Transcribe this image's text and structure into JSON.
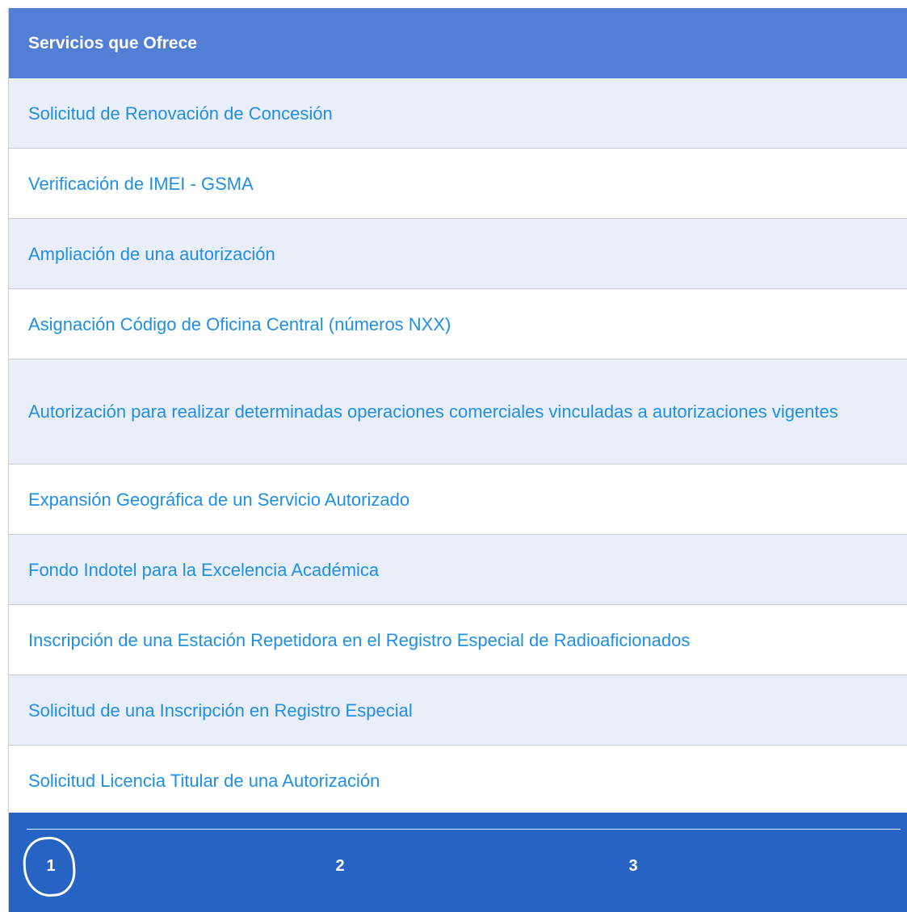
{
  "panel": {
    "title": "Servicios que Ofrece"
  },
  "services": [
    {
      "label": "Solicitud de Renovación de Concesión"
    },
    {
      "label": "Verificación de IMEI - GSMA"
    },
    {
      "label": "Ampliación de una autorización"
    },
    {
      "label": "Asignación Código de Oficina Central (números NXX)"
    },
    {
      "label": "Autorización para realizar determinadas operaciones comerciales vinculadas a autorizaciones vigentes"
    },
    {
      "label": "Expansión Geográfica de un Servicio Autorizado"
    },
    {
      "label": "Fondo Indotel para la Excelencia Académica"
    },
    {
      "label": "Inscripción de una Estación Repetidora en el Registro Especial de Radioaficionados"
    },
    {
      "label": "Solicitud de una Inscripción en Registro Especial"
    },
    {
      "label": "Solicitud Licencia Titular de una Autorización"
    }
  ],
  "pagination": {
    "pages": [
      "1",
      "2",
      "3"
    ],
    "current": "1"
  },
  "colors": {
    "header_bg": "#527fd5",
    "link": "#1f8fe6",
    "row_alt": "#eaeef8",
    "pager_bg": "#2763c2"
  }
}
